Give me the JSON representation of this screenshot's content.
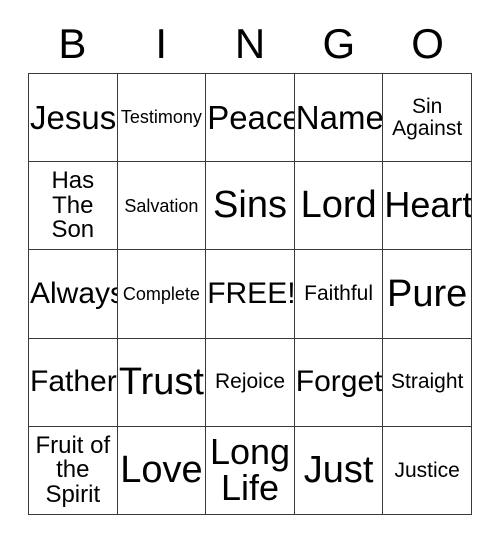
{
  "card": {
    "header_letters": [
      "B",
      "I",
      "N",
      "G",
      "O"
    ],
    "rows": [
      [
        {
          "text": "Jesus",
          "size": "fs-2xl"
        },
        {
          "text": "Testimony",
          "size": "fs-xs"
        },
        {
          "text": "Peace",
          "size": "fs-2xl"
        },
        {
          "text": "Name",
          "size": "fs-2xl"
        },
        {
          "text": "Sin\nAgainst",
          "size": "fs-sm"
        }
      ],
      [
        {
          "text": "Has\nThe\nSon",
          "size": "fs-md"
        },
        {
          "text": "Salvation",
          "size": "fs-xs"
        },
        {
          "text": "Sins",
          "size": "fs-4xl"
        },
        {
          "text": "Lord",
          "size": "fs-4xl"
        },
        {
          "text": "Heart",
          "size": "fs-3xl"
        }
      ],
      [
        {
          "text": "Always",
          "size": "fs-xl"
        },
        {
          "text": "Complete",
          "size": "fs-xs"
        },
        {
          "text": "FREE!",
          "size": "fs-xl"
        },
        {
          "text": "Faithful",
          "size": "fs-sm"
        },
        {
          "text": "Pure",
          "size": "fs-4xl"
        }
      ],
      [
        {
          "text": "Father",
          "size": "fs-xl"
        },
        {
          "text": "Trust",
          "size": "fs-4xl"
        },
        {
          "text": "Rejoice",
          "size": "fs-sm"
        },
        {
          "text": "Forget",
          "size": "fs-xl"
        },
        {
          "text": "Straight",
          "size": "fs-sm"
        }
      ],
      [
        {
          "text": "Fruit of\nthe\nSpirit",
          "size": "fs-md"
        },
        {
          "text": "Love",
          "size": "fs-4xl"
        },
        {
          "text": "Long\nLife",
          "size": "fs-3xl"
        },
        {
          "text": "Just",
          "size": "fs-4xl"
        },
        {
          "text": "Justice",
          "size": "fs-sm"
        }
      ]
    ],
    "colors": {
      "background": "#ffffff",
      "text": "#000000",
      "border": "#3a3a3a"
    }
  }
}
